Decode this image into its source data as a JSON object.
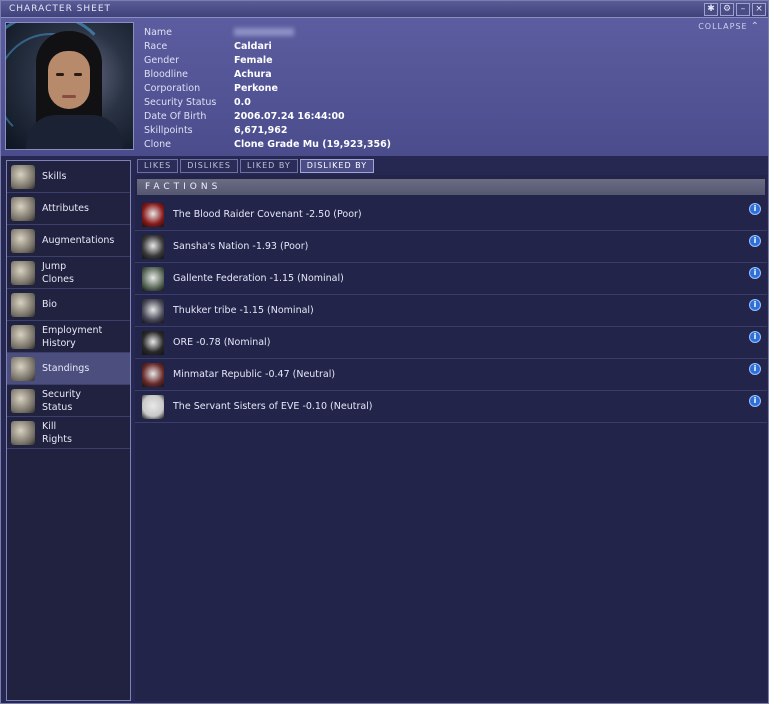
{
  "window": {
    "title": "CHARACTER SHEET",
    "controls": [
      "✱",
      "⚙",
      "–",
      "×"
    ],
    "collapse_label": "COLLAPSE"
  },
  "character": {
    "rows": [
      {
        "label": "Name",
        "value": "",
        "blurred": true
      },
      {
        "label": "Race",
        "value": "Caldari"
      },
      {
        "label": "Gender",
        "value": "Female"
      },
      {
        "label": "Bloodline",
        "value": "Achura"
      },
      {
        "label": "Corporation",
        "value": "Perkone"
      },
      {
        "label": "Security Status",
        "value": "0.0"
      },
      {
        "label": "Date Of Birth",
        "value": "2006.07.24 16:44:00"
      },
      {
        "label": "Skillpoints",
        "value": "6,671,962"
      },
      {
        "label": "Clone",
        "value": "Clone Grade Mu (19,923,356)"
      }
    ]
  },
  "sidebar": {
    "items": [
      {
        "label": "Skills",
        "icon": "skills-icon"
      },
      {
        "label": "Attributes",
        "icon": "attributes-icon"
      },
      {
        "label": "Augmentations",
        "icon": "augmentations-icon"
      },
      {
        "label": "Jump\nClones",
        "icon": "jump-clones-icon"
      },
      {
        "label": "Bio",
        "icon": "bio-icon"
      },
      {
        "label": "Employment\nHistory",
        "icon": "employment-history-icon"
      },
      {
        "label": "Standings",
        "icon": "standings-icon",
        "active": true
      },
      {
        "label": "Security\nStatus",
        "icon": "security-status-icon"
      },
      {
        "label": "Kill\nRights",
        "icon": "kill-rights-icon"
      }
    ]
  },
  "tabs": [
    {
      "label": "LIKES"
    },
    {
      "label": "DISLIKES"
    },
    {
      "label": "LIKED BY"
    },
    {
      "label": "DISLIKED BY",
      "active": true
    }
  ],
  "factions": {
    "header": "FACTIONS",
    "rows": [
      {
        "text": "The Blood Raider Covenant -2.50 (Poor)",
        "icon": "blood-raider-logo-icon",
        "color": "#8b1a1a"
      },
      {
        "text": "Sansha's Nation -1.93 (Poor)",
        "icon": "sansha-logo-icon",
        "color": "#3a3a3a"
      },
      {
        "text": "Gallente Federation -1.15 (Nominal)",
        "icon": "gallente-logo-icon",
        "color": "#5a6a5a"
      },
      {
        "text": "Thukker tribe -1.15 (Nominal)",
        "icon": "thukker-logo-icon",
        "color": "#4a4a5a"
      },
      {
        "text": "ORE -0.78 (Nominal)",
        "icon": "ore-logo-icon",
        "color": "#2a2a2a"
      },
      {
        "text": "Minmatar Republic -0.47 (Neutral)",
        "icon": "minmatar-logo-icon",
        "color": "#6a2a2a"
      },
      {
        "text": "The Servant Sisters of EVE -0.10 (Neutral)",
        "icon": "servant-sisters-logo-icon",
        "color": "#c8c8c8"
      }
    ],
    "info_glyph": "i"
  }
}
